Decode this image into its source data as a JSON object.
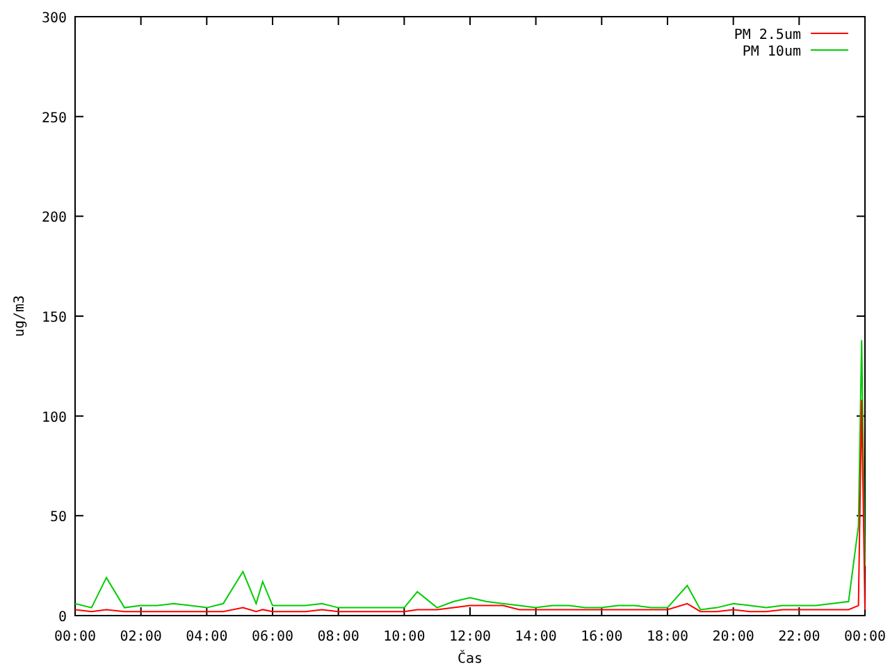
{
  "chart_data": {
    "type": "line",
    "xlabel": "Čas",
    "ylabel": "ug/m3",
    "x": [
      0,
      0.5,
      0.95,
      1.5,
      2,
      2.5,
      3,
      3.5,
      4,
      4.5,
      5.1,
      5.5,
      5.7,
      6,
      6.5,
      7,
      7.5,
      8,
      8.5,
      9,
      9.5,
      10,
      10.4,
      11,
      11.5,
      12,
      12.5,
      13,
      13.5,
      14,
      14.5,
      15,
      15.5,
      16,
      16.5,
      17,
      17.5,
      18,
      18.6,
      19,
      19.5,
      20,
      20.5,
      21,
      21.5,
      22,
      22.5,
      23,
      23.5,
      23.8,
      23.9,
      24
    ],
    "series": [
      {
        "name": "PM 2.5um",
        "color": "#ff0000",
        "values": [
          3,
          2,
          3,
          2,
          2,
          2,
          2,
          2,
          2,
          2,
          4,
          2,
          3,
          2,
          2,
          2,
          3,
          2,
          2,
          2,
          2,
          2,
          3,
          3,
          4,
          5,
          5,
          5,
          3,
          3,
          3,
          3,
          3,
          3,
          3,
          3,
          3,
          3,
          6,
          2,
          2,
          3,
          2,
          2,
          3,
          3,
          3,
          3,
          3,
          5,
          108,
          3
        ]
      },
      {
        "name": "PM 10um",
        "color": "#00cc00",
        "values": [
          6,
          4,
          19,
          4,
          5,
          5,
          6,
          5,
          4,
          6,
          22,
          6,
          17,
          5,
          5,
          5,
          6,
          4,
          4,
          4,
          4,
          4,
          12,
          4,
          7,
          9,
          7,
          6,
          5,
          4,
          5,
          5,
          4,
          4,
          5,
          5,
          4,
          4,
          15,
          3,
          4,
          6,
          5,
          4,
          5,
          5,
          5,
          6,
          7,
          45,
          138,
          25
        ]
      }
    ],
    "legend": true,
    "xlim": [
      0,
      24
    ],
    "ylim": [
      0,
      300
    ],
    "xticks": [
      {
        "value": 0,
        "label": "00:00"
      },
      {
        "value": 2,
        "label": "02:00"
      },
      {
        "value": 4,
        "label": "04:00"
      },
      {
        "value": 6,
        "label": "06:00"
      },
      {
        "value": 8,
        "label": "08:00"
      },
      {
        "value": 10,
        "label": "10:00"
      },
      {
        "value": 12,
        "label": "12:00"
      },
      {
        "value": 14,
        "label": "14:00"
      },
      {
        "value": 16,
        "label": "16:00"
      },
      {
        "value": 18,
        "label": "18:00"
      },
      {
        "value": 20,
        "label": "20:00"
      },
      {
        "value": 22,
        "label": "22:00"
      },
      {
        "value": 24,
        "label": "00:00"
      }
    ],
    "yticks": [
      0,
      50,
      100,
      150,
      200,
      250,
      300
    ]
  }
}
